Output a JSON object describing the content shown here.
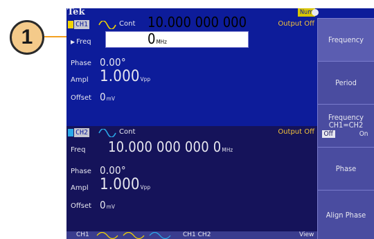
{
  "callout": {
    "number": "1"
  },
  "status": {
    "logo": "Tek",
    "num_indicator": "Num"
  },
  "ch1": {
    "label": "CH1",
    "mode": "Cont",
    "output": "Output Off",
    "swatch_color": "#f2d400",
    "freq_label": "Freq",
    "freq_value": "10.000 000 000 0",
    "freq_unit": "MHz",
    "phase_label": "Phase",
    "phase_value": "0.00°",
    "ampl_label": "Ampl",
    "ampl_value": "1.000",
    "ampl_unit": "Vpp",
    "offset_label": "Offset",
    "offset_value": "0",
    "offset_unit": "mV"
  },
  "ch2": {
    "label": "CH2",
    "mode": "Cont",
    "output": "Output Off",
    "swatch_color": "#2aa8e8",
    "freq_label": "Freq",
    "freq_value": "10.000 000 000 0",
    "freq_unit": "MHz",
    "phase_label": "Phase",
    "phase_value": "0.00°",
    "ampl_label": "Ampl",
    "ampl_value": "1.000",
    "ampl_unit": "Vpp",
    "offset_label": "Offset",
    "offset_value": "0",
    "offset_unit": "mV"
  },
  "menu": {
    "frequency": "Frequency",
    "period": "Period",
    "freq_ch_line1": "Frequency",
    "freq_ch_line2": "CH1=CH2",
    "toggle_off": "Off",
    "toggle_on": "On",
    "phase": "Phase",
    "align_phase": "Align Phase"
  },
  "bottom": {
    "tab1": "CH1",
    "tab2": "CH1  CH2",
    "tab3": "View"
  },
  "colors": {
    "screen_bg": "#0d1c9a",
    "ch2_bg": "#15135a",
    "menu_bg": "#4a4ca0",
    "output_off": "#f3c23a",
    "callout_fill": "#f4ca8a",
    "callout_line": "#f3a020"
  }
}
